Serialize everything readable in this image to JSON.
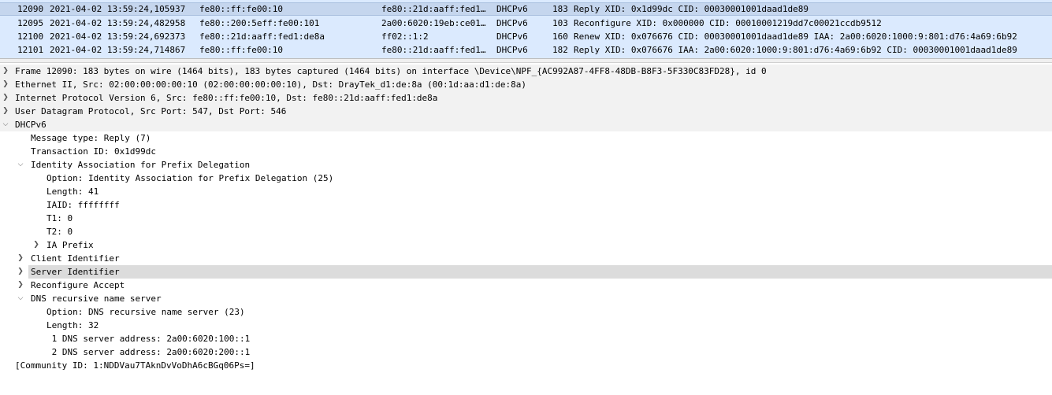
{
  "packet_list": {
    "rows": [
      {
        "no": "12090",
        "time": "2021-04-02 13:59:24,105937",
        "source": "fe80::ff:fe00:10",
        "destination": "fe80::21d:aaff:fed1…",
        "protocol": "DHCPv6",
        "length": "183",
        "info": "Reply XID: 0x1d99dc CID: 00030001001daad1de89"
      },
      {
        "no": "12095",
        "time": "2021-04-02 13:59:24,482958",
        "source": "fe80::200:5eff:fe00:101",
        "destination": "2a00:6020:19eb:ce01…",
        "protocol": "DHCPv6",
        "length": "103",
        "info": "Reconfigure XID: 0x000000 CID: 00010001219dd7c00021ccdb9512"
      },
      {
        "no": "12100",
        "time": "2021-04-02 13:59:24,692373",
        "source": "fe80::21d:aaff:fed1:de8a",
        "destination": "ff02::1:2",
        "protocol": "DHCPv6",
        "length": "160",
        "info": "Renew XID: 0x076676 CID: 00030001001daad1de89 IAA: 2a00:6020:1000:9:801:d76:4a69:6b92"
      },
      {
        "no": "12101",
        "time": "2021-04-02 13:59:24,714867",
        "source": "fe80::ff:fe00:10",
        "destination": "fe80::21d:aaff:fed1…",
        "protocol": "DHCPv6",
        "length": "182",
        "info": "Reply XID: 0x076676 IAA: 2a00:6020:1000:9:801:d76:4a69:6b92 CID: 00030001001daad1de89"
      }
    ]
  },
  "details": {
    "frame": "Frame 12090: 183 bytes on wire (1464 bits), 183 bytes captured (1464 bits) on interface \\Device\\NPF_{AC992A87-4FF8-48DB-B8F3-5F330C83FD28}, id 0",
    "ethernet": "Ethernet II, Src: 02:00:00:00:00:10 (02:00:00:00:00:10), Dst: DrayTek_d1:de:8a (00:1d:aa:d1:de:8a)",
    "ipv6": "Internet Protocol Version 6, Src: fe80::ff:fe00:10, Dst: fe80::21d:aaff:fed1:de8a",
    "udp": "User Datagram Protocol, Src Port: 547, Dst Port: 546",
    "dhcpv6": "DHCPv6",
    "message_type": "Message type: Reply (7)",
    "transaction_id": "Transaction ID: 0x1d99dc",
    "ia_pd": "Identity Association for Prefix Delegation",
    "ia_pd_option": "Option: Identity Association for Prefix Delegation (25)",
    "ia_pd_length": "Length: 41",
    "iaid": "IAID: ffffffff",
    "t1": "T1: 0",
    "t2": "T2: 0",
    "ia_prefix": "IA Prefix",
    "client_identifier": "Client Identifier",
    "server_identifier": "Server Identifier",
    "reconfigure_accept": "Reconfigure Accept",
    "dns": "DNS recursive name server",
    "dns_option": "Option: DNS recursive name server (23)",
    "dns_length": "Length: 32",
    "dns_server_1": " 1 DNS server address: 2a00:6020:100::1",
    "dns_server_2": " 2 DNS server address: 2a00:6020:200::1",
    "community_id": "[Community ID: 1:NDDVau7TAknDvVoDhA6cBGq06Ps=]"
  },
  "icons": {
    "collapsed": "chevron-right-icon",
    "expanded": "chevron-down-icon"
  },
  "colors": {
    "packet_list_bg": "#dbeafe",
    "selected_row": "#c5d6ee",
    "highlight_row": "#dcdcdc"
  }
}
